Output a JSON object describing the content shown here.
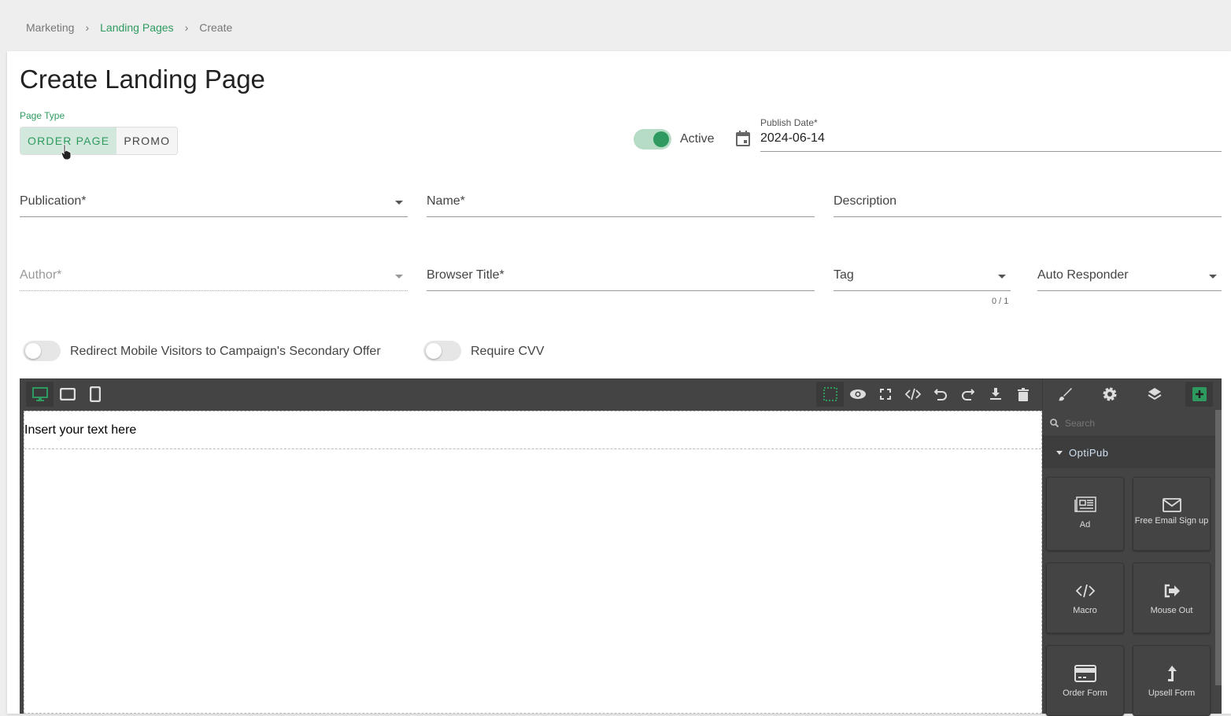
{
  "breadcrumb": [
    "Marketing",
    "Landing Pages",
    "Create"
  ],
  "title": "Create Landing Page",
  "page_type": {
    "label": "Page Type",
    "options": [
      "ORDER PAGE",
      "PROMO"
    ],
    "selected": "ORDER PAGE"
  },
  "active": {
    "label": "Active",
    "on": true
  },
  "publish_date": {
    "label": "Publish Date*",
    "value": "2024-06-14"
  },
  "fields": {
    "publication": "Publication*",
    "name": "Name*",
    "description": "Description",
    "author": "Author*",
    "browser_title": "Browser Title*",
    "tag": "Tag",
    "tag_counter": "0 / 1",
    "auto_responder": "Auto Responder"
  },
  "toggles": {
    "redirect": {
      "label": "Redirect Mobile Visitors to Campaign's Secondary Offer",
      "on": false
    },
    "cvv": {
      "label": "Require CVV",
      "on": false
    }
  },
  "editor": {
    "canvas_text": "Insert your text here",
    "search_placeholder": "Search",
    "category": "OptiPub",
    "blocks": [
      {
        "label": "Ad",
        "icon": "newspaper-icon"
      },
      {
        "label": "Free Email Sign up",
        "icon": "envelope-icon"
      },
      {
        "label": "Macro",
        "icon": "code-icon"
      },
      {
        "label": "Mouse Out",
        "icon": "sign-out-icon"
      },
      {
        "label": "Order Form",
        "icon": "credit-card-icon"
      },
      {
        "label": "Upsell Form",
        "icon": "level-up-icon"
      }
    ],
    "accent": "#2e9a5f"
  }
}
